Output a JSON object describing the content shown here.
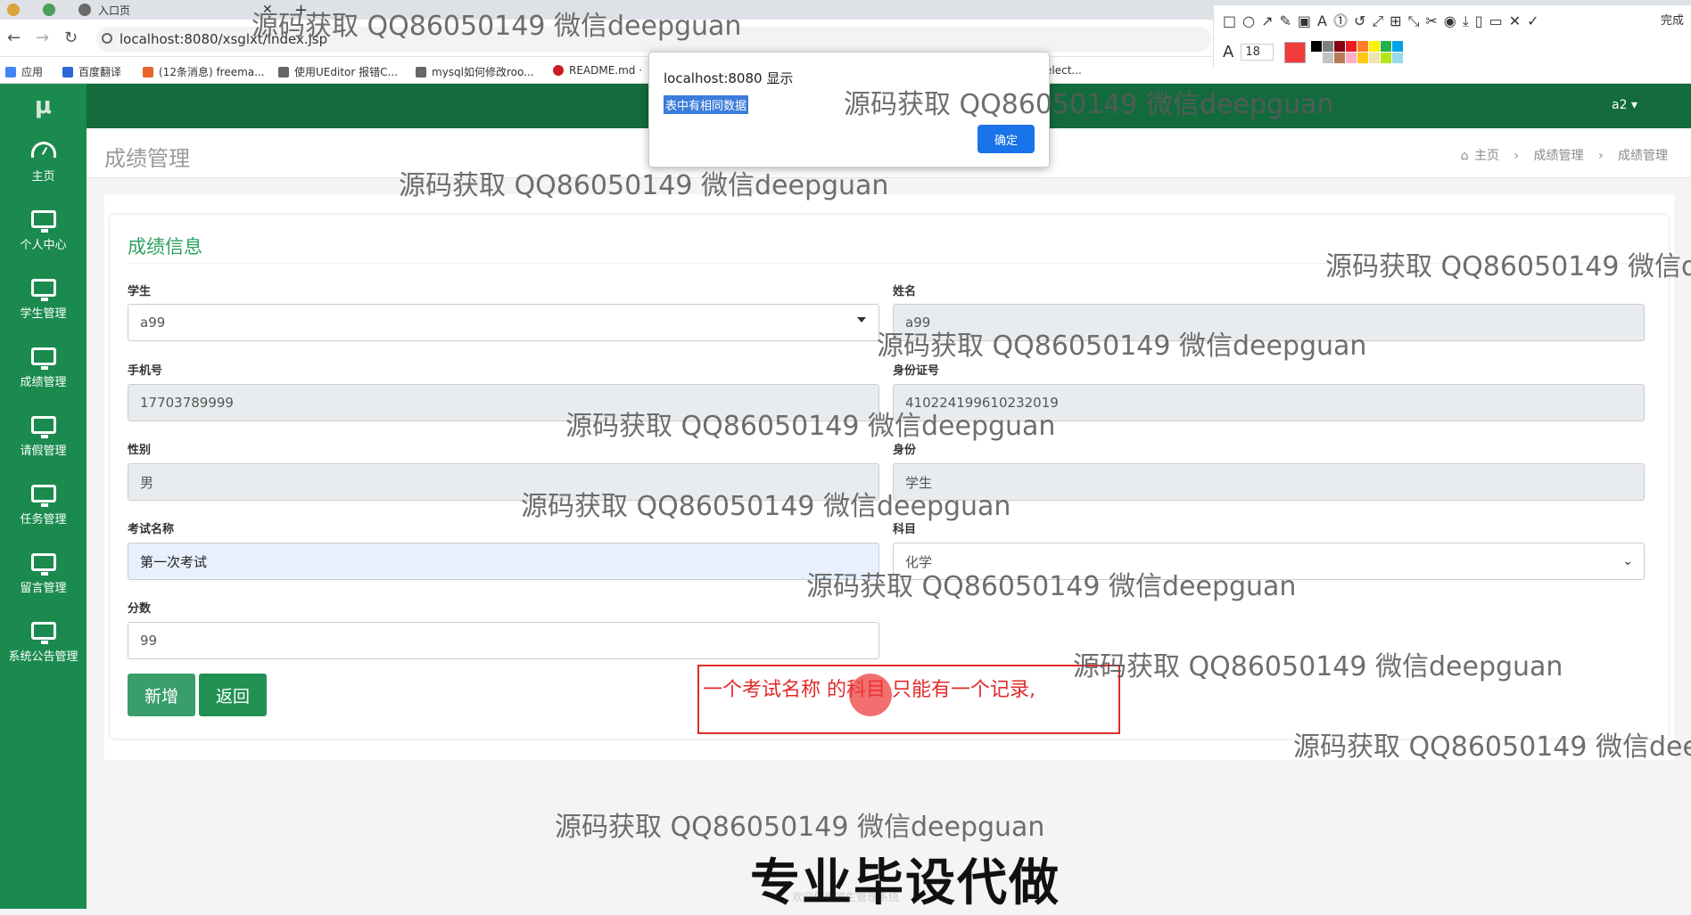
{
  "browser": {
    "tab_title": "入口页",
    "url": "localhost:8080/xsglxt/index.jsp",
    "bookmarks": [
      "应用",
      "百度翻译",
      "(12条消息) freema...",
      "使用UEditor 报错C...",
      "mysql如何修改roo...",
      "README.md ·",
      "elect..."
    ]
  },
  "toolbar": {
    "font_size": "18",
    "done_label": "完成",
    "current_color": "#f23c3c",
    "palette": [
      "#000000",
      "#7f7f7f",
      "#880015",
      "#ed1c24",
      "#ff7f27",
      "#fff200",
      "#22b14c",
      "#00a2e8",
      "#ffffff",
      "#c3c3c3",
      "#b97a57",
      "#ffaec9",
      "#ffc90e",
      "#efe4b0",
      "#b5e61d",
      "#99d9ea"
    ]
  },
  "app": {
    "logo": "μ",
    "user": "a2 ▾",
    "sidebar": [
      {
        "label": "主页",
        "icon": "dashboard-icon"
      },
      {
        "label": "个人中心",
        "icon": "monitor-icon"
      },
      {
        "label": "学生管理",
        "icon": "monitor-icon"
      },
      {
        "label": "成绩管理",
        "icon": "monitor-icon"
      },
      {
        "label": "请假管理",
        "icon": "monitor-icon"
      },
      {
        "label": "任务管理",
        "icon": "monitor-icon"
      },
      {
        "label": "留言管理",
        "icon": "monitor-icon"
      },
      {
        "label": "系统公告管理",
        "icon": "monitor-icon"
      }
    ],
    "page_title": "成绩管理",
    "breadcrumb": [
      "主页",
      "成绩管理",
      "成绩管理"
    ],
    "breadcrumb_sep": "›",
    "home_icon": "⌂"
  },
  "form": {
    "title": "成绩信息",
    "fields": {
      "student": {
        "label": "学生",
        "value": "a99"
      },
      "name": {
        "label": "姓名",
        "value": "a99"
      },
      "phone": {
        "label": "手机号",
        "value": "17703789999"
      },
      "idcard": {
        "label": "身份证号",
        "value": "410224199610232019"
      },
      "gender": {
        "label": "性别",
        "value": "男"
      },
      "identity": {
        "label": "身份",
        "value": "学生"
      },
      "exam": {
        "label": "考试名称",
        "value": "第一次考试"
      },
      "subject": {
        "label": "科目",
        "value": "化学"
      },
      "score": {
        "label": "分数",
        "value": "99"
      }
    },
    "add_label": "新增",
    "back_label": "返回"
  },
  "dialog": {
    "title": "localhost:8080 显示",
    "message": "表中有相同数据",
    "ok_label": "确定"
  },
  "annotation": "一个考试名称 的科目  只能有一个记录,",
  "watermark": "源码获取 QQ86050149 微信deepguan",
  "promo": "专业毕设代做",
  "footer": "欢迎使用学生管理系统"
}
